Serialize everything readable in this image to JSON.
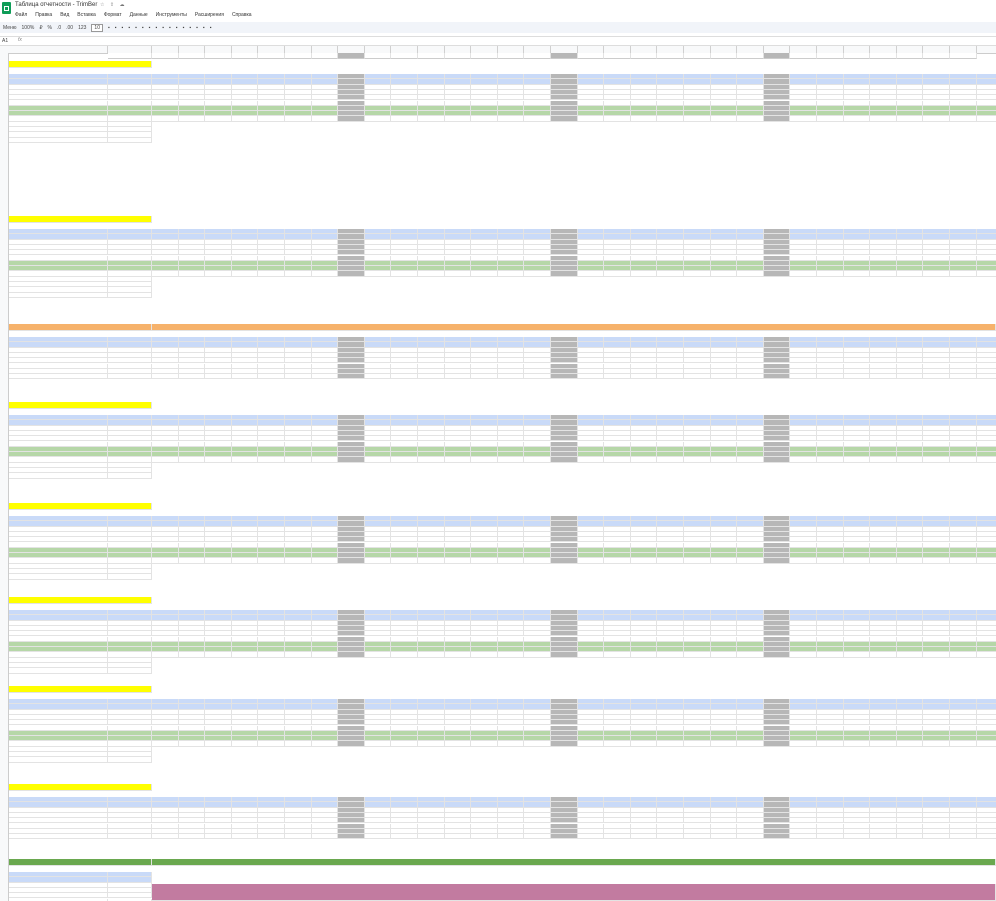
{
  "app": {
    "title": "Таблица отчетности - TrimBer",
    "menu": [
      "Файл",
      "Правка",
      "Вид",
      "Вставка",
      "Формат",
      "Данные",
      "Инструменты",
      "Расширения",
      "Справка"
    ],
    "toolbar": [
      "Меню",
      "100%",
      "₽",
      "%",
      ".0",
      ".00",
      "123",
      "10"
    ],
    "namebox": "A1",
    "fx": "fx"
  },
  "columns": {
    "letters": [
      "A",
      "B",
      "C",
      "D",
      "E",
      "F",
      "G",
      "H",
      "I",
      "J",
      "K",
      "L",
      "M",
      "N",
      "O",
      "P",
      "Q",
      "R",
      "S",
      "T",
      "U",
      "V",
      "W",
      "X",
      "Y",
      "Z",
      "AA",
      "AB",
      "AC",
      "AD",
      "AE",
      "AF",
      "AG",
      "AH",
      "AI",
      "AJ",
      "AK",
      "AL"
    ],
    "dates": [
      "Итого",
      "01.01",
      "02.01",
      "03.01",
      "04.01",
      "05.01",
      "06.01",
      "07.01",
      "Итог недели",
      "08.01",
      "09.01",
      "10.01",
      "11.01",
      "12.01",
      "13.01",
      "14.01",
      "Итог недели",
      "15.01",
      "16.01",
      "17.01",
      "18.01",
      "19.01",
      "20.01",
      "21.01",
      "Итог недели",
      "22.01",
      "23.01",
      "24.01",
      "25.01",
      "26.01",
      "27.01",
      "28.01"
    ]
  },
  "sections": [
    {
      "title": "YandexDirect - трафик Landing",
      "link": "",
      "rows": [
        "Затраты на рекламу в кабинете",
        "Показы",
        "Клики",
        "CTR",
        "CPC (стоимость клика, руб)",
        "Конверсии",
        "Кол-во запросов на разработку/бюджет РК",
        "CPL (стоимость рекламной заявки, руб)",
        "Продажи",
        "Стоимость продажи",
        "Оплаченные",
        "Оплата",
        "Затраты на рекламу оплаченные"
      ],
      "totals": [
        "226291,07",
        "",
        "",
        "",
        "0,38",
        "",
        "",
        "",
        "308,44",
        "",
        "",
        "",
        ""
      ]
    },
    {
      "title": "YandexDirect - Новые Мск ремонт 2.0",
      "link": "",
      "rows": [
        "Затраты на рекламу в кабинете",
        "Показы",
        "Клики",
        "CTR",
        "CPC (стоимость клика, руб)",
        "Конверсии",
        "Кол-во запросов на разработку/бюджет РК",
        "CPL (стоимость рекламной заявки, руб)",
        "Продажи",
        "Стоимость продажи",
        "Оплаченные",
        "Оплата",
        "Затраты на рекламу оплаченные"
      ],
      "totals": [
        "1143240,00",
        "456007,00",
        "345,00",
        "",
        "25,00",
        "",
        "",
        "",
        "508,31",
        "",
        "",
        "",
        ""
      ]
    },
    {
      "title": "Яндекс - ИТОГО",
      "link": "",
      "rows": [
        "Затраты на рекламу в кабинете",
        "Показы",
        "Кол-во запросов на РК",
        "CPL (стоимость заявки)",
        "Продажи",
        "Стоимость продажи",
        "Оплата",
        "Затраты на рекламу оплаченные"
      ],
      "totals": [
        "р.597 908,87",
        "",
        "р.982,74",
        "",
        "0,00",
        "",
        "",
        ""
      ]
    },
    {
      "title": "Инстаграм - гайд",
      "link": "https://taplink.cc/",
      "rows": [
        "Затраты на рекламу в кабинете",
        "Показы",
        "Клики",
        "CTR",
        "CPC (стоимость клика, руб)",
        "Конверсии",
        "Кол-во запросов на РК",
        "CPL (стоимость рекламной заявки, руб)",
        "Продажи",
        "Стоимость продажи",
        "Конверсия в заявку",
        "Конверсия заявок в продажи"
      ],
      "totals": [
        "60082,00",
        "340438,00",
        "111,37",
        "",
        "",
        "",
        "",
        "",
        "2198,53",
        "",
        "",
        ""
      ]
    },
    {
      "title": "Инстаграм - Новые Там",
      "link": "https://taplink.cc/",
      "rows": [
        "Затраты на рекламу в кабинете",
        "Показы",
        "Клики",
        "CTR",
        "CPC (стоимость клика, руб)",
        "Конверсии",
        "Кол-во запросов на РК",
        "CPL (стоимость рекламной заявки, руб)",
        "Продажи",
        "Стоимость продажи",
        "Конверсия в заявку",
        "Конверсия заявок в продажи"
      ],
      "totals": [
        "111559,00",
        "1423730,00",
        "128,70",
        "",
        "48,85",
        "0,05%",
        "",
        "1352,11",
        "",
        "",
        "",
        ""
      ]
    },
    {
      "title": "Инстаграм - Лид-формы всего",
      "link": "",
      "rows": [
        "Затраты на рекламу в кабинете",
        "Показы",
        "Клики",
        "CTR",
        "CPC (стоимость клика, руб)",
        "CPM",
        "Кол-во запросов на РК",
        "CPL (стоимость рекламной заявки, руб)",
        "Продажи",
        "Стоимость продажи",
        "Конверсия в заявку",
        "Конверсия заявок в продажи"
      ],
      "totals": [
        "5848763,00",
        "1526403,00",
        "177,96",
        "864465,00",
        "",
        "0,60%",
        "285,00",
        "851,70",
        "",
        "",
        "",
        ""
      ]
    },
    {
      "title": "Инстаграм - Подписчики Telegram",
      "link": "https://taplink.cc/",
      "rows": [
        "Затраты на рекламу в кабинете",
        "Показы",
        "Клики",
        "CTR",
        "CPC (стоимость клика, руб)",
        "Конверсии",
        "Кол-во запросов на РК",
        "CPL (стоимость рекламной заявки, руб)",
        "Продажи",
        "Стоимость продажи",
        "Конверсия в заявку",
        "Конверсия заявок в продажи"
      ],
      "totals": [
        "31098,00",
        "19058,00",
        "65,71",
        "",
        "26,37",
        "",
        "",
        "",
        "",
        "",
        "",
        ""
      ]
    },
    {
      "title": "Инстаграм - ИТОГО",
      "link": "",
      "rows": [
        "Затраты на рекламу в кабинете",
        "Показы",
        "Кол-во запросов на РК",
        "CPL",
        "Продажи",
        "Стоимость продажи",
        "Оплата",
        "Затраты на рекламу оплаченные"
      ],
      "totals": [
        "",
        "58562,00",
        "",
        "р.1 581,00",
        "",
        "",
        "",
        ""
      ]
    },
    {
      "title": "Итого ВСЕГО",
      "link": "",
      "rows": [
        "Затраты",
        "Кол-во запросов",
        "CPL",
        "Продажи",
        "Стоимость продажи",
        "Оплата",
        "Стоимость продажи итого"
      ],
      "totals": [
        "р.1 014 986,88",
        "",
        "",
        "",
        "",
        "",
        "р.4 529,71"
      ]
    }
  ],
  "sample_values": [
    "#DIV/0!",
    "0,00",
    "р.0,00",
    "42,09",
    "38,17",
    "#DIV/0!",
    "0,00",
    "р.1 081,00",
    "12,86",
    "6,84"
  ],
  "colors": {
    "title": "#ffff00",
    "orange": "#f6b26b",
    "blue": "#c9daf8",
    "green": "#b6d7a8",
    "week": "#b7b7b7",
    "dark_green": "#6aa84f",
    "mauve": "#c27ba0"
  }
}
